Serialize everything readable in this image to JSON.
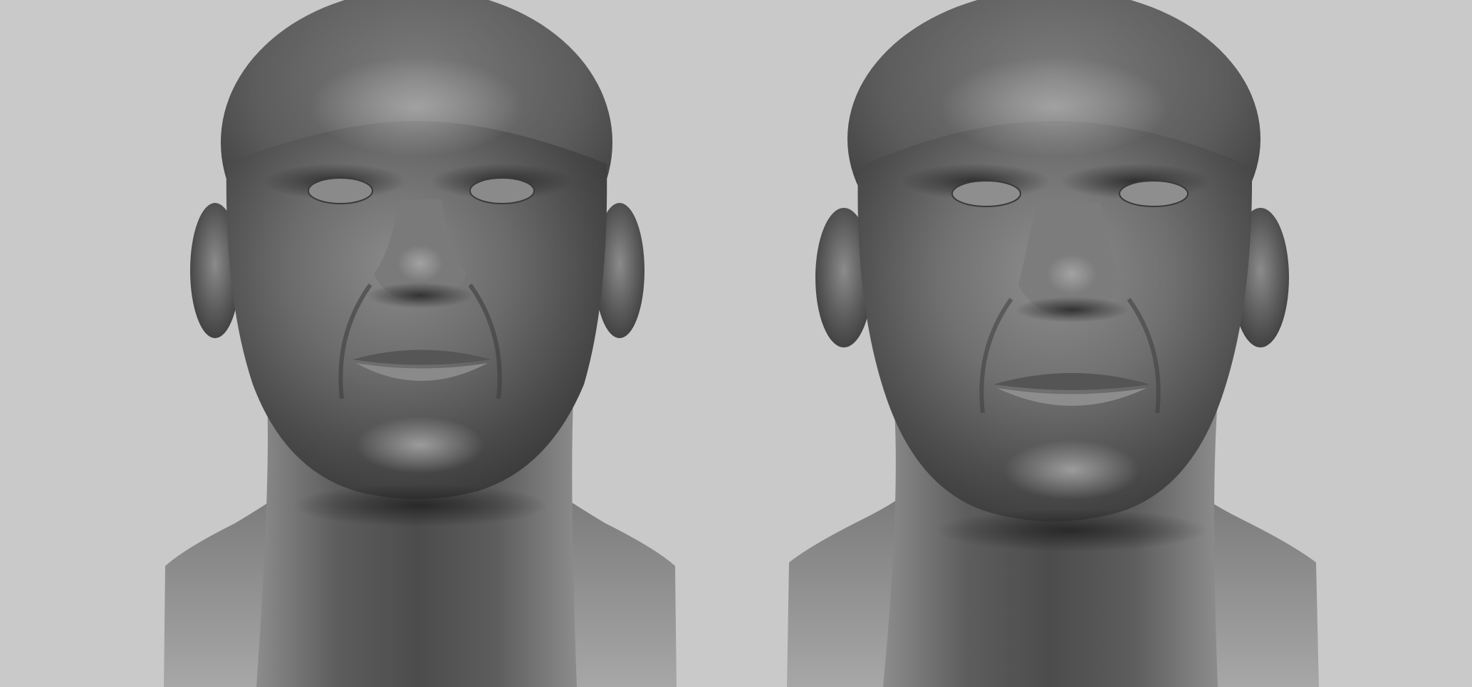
{
  "scene": {
    "background_color": "#c9c9c9",
    "subjects": [
      {
        "name": "sculpt-bust-left",
        "detail": "high",
        "tone": "#6a6a6a"
      },
      {
        "name": "sculpt-bust-right",
        "detail": "planar",
        "tone": "#6f6f6f"
      }
    ]
  }
}
